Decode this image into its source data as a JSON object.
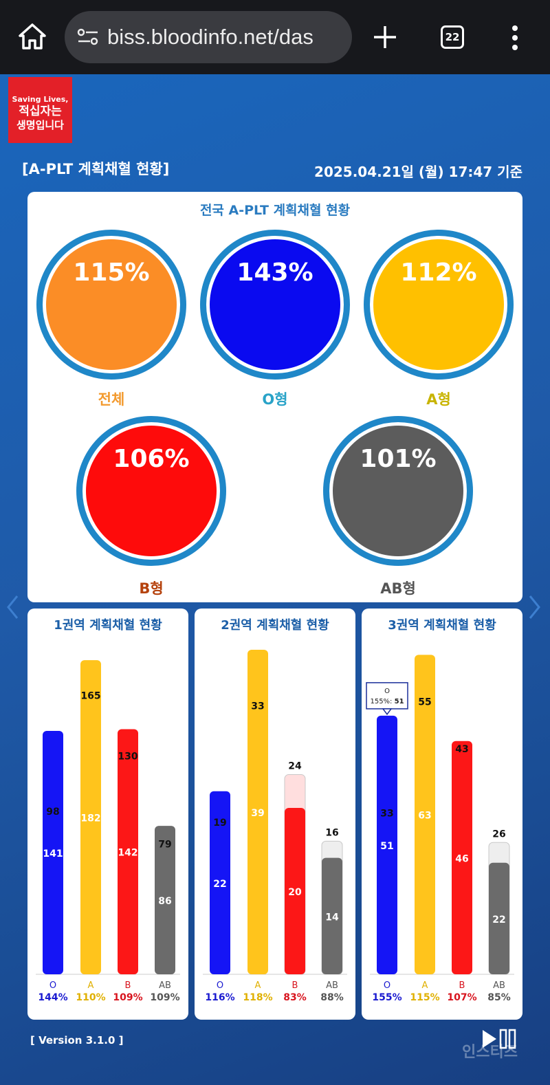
{
  "browser": {
    "url": "biss.bloodinfo.net/das",
    "tab_count": "22"
  },
  "logo": {
    "line1": "Saving Lives,",
    "line2": "적십자는",
    "line3": "생명입니다"
  },
  "header": {
    "title": "[A-PLT 계획채혈 현황]",
    "timestamp": "2025.04.21일 (월) 17:47 기준"
  },
  "national": {
    "title": "전국 A-PLT 계획채혈 현황",
    "bubbles": [
      {
        "pct": "115%",
        "label": "전체",
        "color": "#fb8d26",
        "label_color": "#f39a2e"
      },
      {
        "pct": "143%",
        "label": "O형",
        "color": "#0a0af0",
        "label_color": "#29a3c8"
      },
      {
        "pct": "112%",
        "label": "A형",
        "color": "#ffc000",
        "label_color": "#c8b400"
      },
      {
        "pct": "106%",
        "label": "B형",
        "color": "#fe0b0b",
        "label_color": "#b5420d"
      },
      {
        "pct": "101%",
        "label": "AB형",
        "color": "#5c5c5c",
        "label_color": "#555555"
      }
    ]
  },
  "colors": {
    "O": "#1515f5",
    "A": "#ffc41c",
    "B": "#fc1717",
    "AB": "#6b6b6b",
    "O_pct": "#1a1ad0",
    "A_pct": "#e0b000",
    "B_pct": "#d8141e",
    "AB_pct": "#555555",
    "ring": "#1f87c8"
  },
  "regions": [
    {
      "title": "1권역 계획채혈 현황",
      "bars": [
        {
          "type": "O",
          "actual": 141,
          "plan": 98,
          "pct": "144%"
        },
        {
          "type": "A",
          "actual": 182,
          "plan": 165,
          "pct": "110%"
        },
        {
          "type": "B",
          "actual": 142,
          "plan": 130,
          "pct": "109%"
        },
        {
          "type": "AB",
          "actual": 86,
          "plan": 79,
          "pct": "109%"
        }
      ],
      "ymax": 188
    },
    {
      "title": "2권역 계획채혈 현황",
      "bars": [
        {
          "type": "O",
          "actual": 22,
          "plan": 19,
          "pct": "116%"
        },
        {
          "type": "A",
          "actual": 39,
          "plan": 33,
          "pct": "118%"
        },
        {
          "type": "B",
          "actual": 20,
          "plan": 24,
          "pct": "83%"
        },
        {
          "type": "AB",
          "actual": 14,
          "plan": 16,
          "pct": "88%"
        }
      ],
      "ymax": 39
    },
    {
      "title": "3권역 계획채혈 현황",
      "bars": [
        {
          "type": "O",
          "actual": 51,
          "plan": 33,
          "pct": "155%"
        },
        {
          "type": "A",
          "actual": 63,
          "plan": 55,
          "pct": "115%"
        },
        {
          "type": "B",
          "actual": 46,
          "plan": 43,
          "pct": "107%"
        },
        {
          "type": "AB",
          "actual": 22,
          "plan": 26,
          "pct": "85%"
        }
      ],
      "ymax": 64,
      "tooltip": {
        "line1": "O",
        "line2_prefix": "155%: ",
        "line2_value": "51"
      }
    }
  ],
  "footer": {
    "version": "[ Version 3.1.0 ]",
    "watermark": "인스티즈"
  }
}
